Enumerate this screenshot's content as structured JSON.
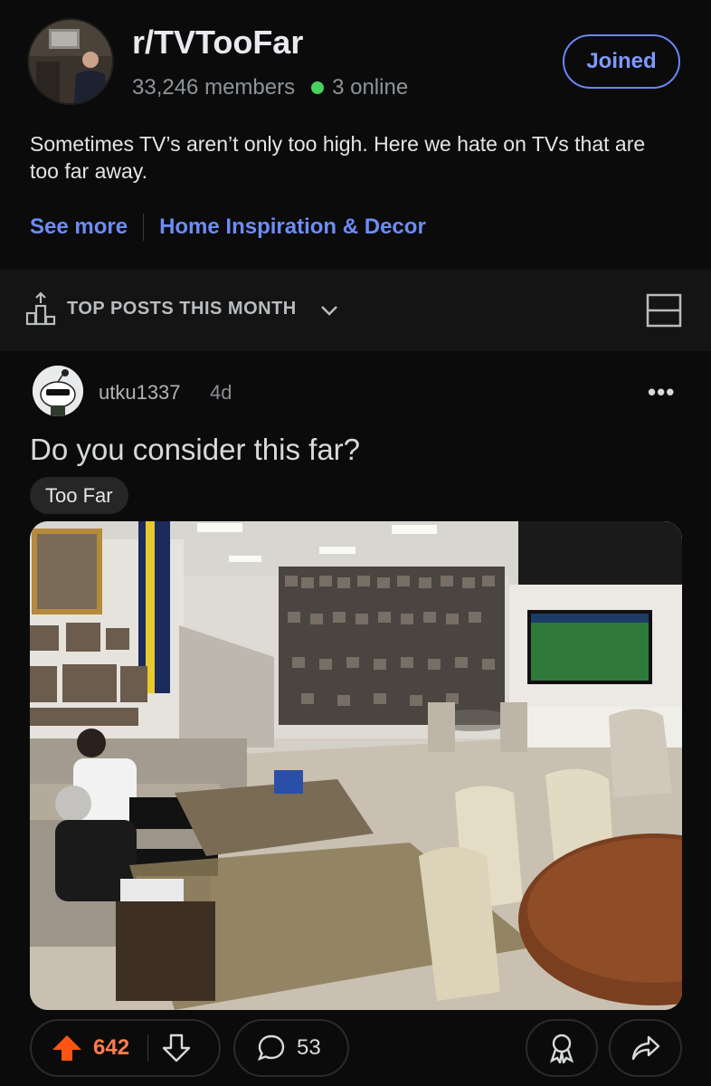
{
  "subreddit": {
    "name": "r/TVTooFar",
    "members": "33,246 members",
    "online": "3 online",
    "joined_label": "Joined",
    "description": "Sometimes TV’s aren’t only too high. Here we hate on TVs that are too far away.",
    "links": [
      "See more",
      "Home Inspiration & Decor"
    ],
    "accent_color": "#6d8cf5"
  },
  "sort": {
    "label": "TOP POSTS THIS MONTH",
    "icon": "podium-icon",
    "layout_icon": "card-layout-icon"
  },
  "post": {
    "author": "utku1337",
    "age": "4d",
    "more_label": "•••",
    "title": "Do you consider this far?",
    "flair": "Too Far",
    "image_alt": "Large lounge room with sofas, framed photo wall, and a distant wall-mounted TV showing a football match",
    "upvotes": "642",
    "comments": "53",
    "upvote_color": "#ff5414"
  }
}
